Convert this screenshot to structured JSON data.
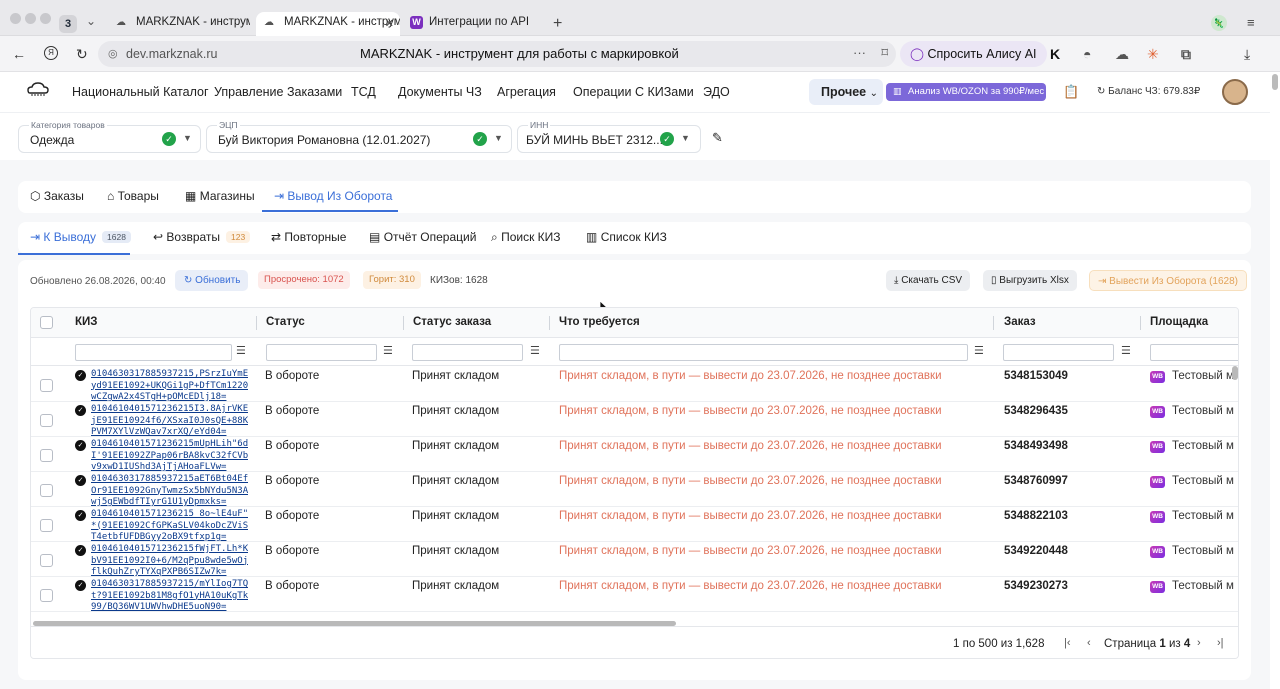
{
  "browser": {
    "tab_count": "3",
    "tabs": [
      {
        "title": "MARKZNAK - инструмент"
      },
      {
        "title": "MARKZNAK - инструм"
      },
      {
        "title": "Интеграции по API"
      }
    ],
    "address": "dev.markznak.ru",
    "page_title": "MARKZNAK - инструмент для работы с маркировкой",
    "alice_label": "Спросить Алису AI"
  },
  "nav": {
    "items": [
      "Национальный Каталог",
      "Управление Заказами",
      "ТСД",
      "Документы ЧЗ",
      "Агрегация",
      "Операции С КИЗами",
      "ЭДО"
    ],
    "more_label": "Прочее",
    "analysis_label": "Анализ WB/OZON за 990₽/мес",
    "balance": "Баланс ЧЗ: 679.83₽"
  },
  "filters": {
    "category": {
      "label": "Категория товаров",
      "value": "Одежда"
    },
    "signature": {
      "label": "ЭЦП",
      "value": "Буй Виктория Романовна (12.01.2027)"
    },
    "inn": {
      "label": "ИНН",
      "value": "БУЙ МИНЬ ВЬЕТ 2312..."
    }
  },
  "section_tabs": [
    "Заказы",
    "Товары",
    "Магазины",
    "Вывод Из Оборота"
  ],
  "sub_tabs": {
    "k_vyvodu": {
      "label": "К Выводу",
      "count": "1628"
    },
    "vozvraty": {
      "label": "Возвраты",
      "count": "123"
    },
    "povtornye": "Повторные",
    "otchet": "Отчёт Операций",
    "poisk": "Поиск КИЗ",
    "spisok": "Список КИЗ"
  },
  "toolbar": {
    "updated": "Обновлено 26.08.2026, 00:40",
    "refresh": "Обновить",
    "overdue": "Просрочено: 1072",
    "burning": "Горит: 310",
    "kiz_count": "КИЗов: 1628",
    "csv": "Скачать CSV",
    "xlsx": "Выгрузить Xlsx",
    "withdraw": "Вывести Из Оборота (1628)"
  },
  "table": {
    "headers": [
      "КИЗ",
      "Статус",
      "Статус заказа",
      "Что требуется",
      "Заказ",
      "Площадка"
    ],
    "rows": [
      {
        "kiz": "0104630317885937215,PSrzIuYmE\nyd91EE1092+UKQGi1gP+DfTCm1220\nwCZgwA2x4STgH+pOMcEDlj18=",
        "status": "В обороте",
        "order_status": "Принят складом",
        "need": "Принят складом, в пути — вывести до 23.07.2026, не позднее доставки",
        "order": "5348153049",
        "platform": "Тестовый м"
      },
      {
        "kiz": "0104610401571236215I3.8AjrVKE\njE91EE10924f6/XSxaI0J0sQE+88K\nPVM7XYlVzWQav7xrXQ/eYd04=",
        "status": "В обороте",
        "order_status": "Принят складом",
        "need": "Принят складом, в пути — вывести до 23.07.2026, не позднее доставки",
        "order": "5348296435",
        "platform": "Тестовый м"
      },
      {
        "kiz": "0104610401571236215mUpHLih\"6d\nI'91EE1092ZPap06rBA8kvC32fCVb\nv9xwD1IUShd3AjTjAHoaFLVw=",
        "status": "В обороте",
        "order_status": "Принят складом",
        "need": "Принят складом, в пути — вывести до 23.07.2026, не позднее доставки",
        "order": "5348493498",
        "platform": "Тестовый м"
      },
      {
        "kiz": "0104630317885937215aET6Bt04Ef\nOr91EE1092GnyTwmzSx5bNYdu5N3A\nwj5gEWbdfTIyrG1U1yDpmxks=",
        "status": "В обороте",
        "order_status": "Принят складом",
        "need": "Принят складом, в пути — вывести до 23.07.2026, не позднее доставки",
        "order": "5348760997",
        "platform": "Тестовый м"
      },
      {
        "kiz": "0104610401571236215 8o~lE4uF\"_\n*(91EE1092CfGPKaSLV04koDcZViS\nT4etbfUFDBGyy2oBX9tfxp1g=",
        "status": "В обороте",
        "order_status": "Принят складом",
        "need": "Принят складом, в пути — вывести до 23.07.2026, не позднее доставки",
        "order": "5348822103",
        "platform": "Тестовый м"
      },
      {
        "kiz": "0104610401571236215fWjFT.Lh*K\nbV91EE1092I0+6/M2qPpu8wde5wOj\nflkQuhZryTYXqPXPB6SIZw7k=",
        "status": "В обороте",
        "order_status": "Принят складом",
        "need": "Принят складом, в пути — вывести до 23.07.2026, не позднее доставки",
        "order": "5349220448",
        "platform": "Тестовый м"
      },
      {
        "kiz": "0104630317885937215/mYlIog7TQ\nt?91EE1092b81M8gfO1yHA10uKgTk\n99/BQ36WV1UWVhwDHE5uoN90=",
        "status": "В обороте",
        "order_status": "Принят складом",
        "need": "Принят складом, в пути — вывести до 23.07.2026, не позднее доставки",
        "order": "5349230273",
        "platform": "Тестовый м"
      }
    ]
  },
  "pagination": {
    "range": "1 по 500 из 1,628",
    "page_label": "Страница",
    "page_current": "1",
    "page_of": "из",
    "page_total": "4"
  },
  "colors": {
    "accent": "#3b6fd8",
    "warning_text": "#e0735b",
    "success": "#22a34a",
    "wb_brand": "#a53ad0"
  }
}
